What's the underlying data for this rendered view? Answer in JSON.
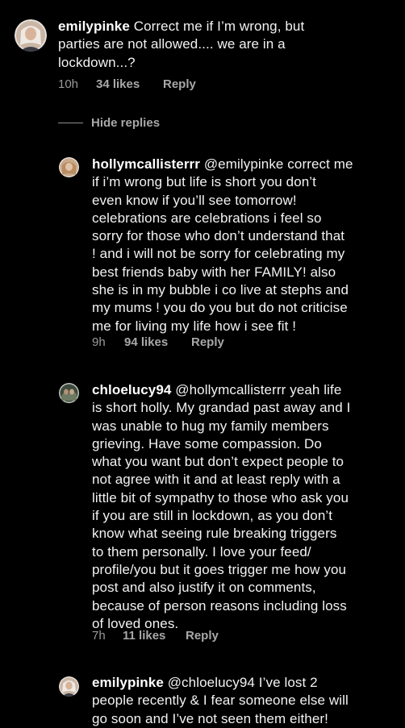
{
  "comments": [
    {
      "username": "emilypinke",
      "lines": [
        "Correct me if I’m wrong, but",
        "parties are not allowed.... we are in a",
        "lockdown...?"
      ],
      "time": "10h",
      "likes": "34 likes",
      "reply": "Reply"
    },
    {
      "username": "hollymcallisterrr",
      "lines": [
        "@emilypinke correct me",
        "if i’m wrong but life is short you don’t",
        "even know if you’ll see tomorrow!",
        "celebrations are celebrations i feel so",
        "sorry for those who don’t understand that",
        "! and i will not be sorry for celebrating my",
        "best friends baby with her FAMILY! also",
        "she is in my bubble i co live at stephs and",
        "my mums ! you do you but do not criticise",
        "me for living my life how i see fit !"
      ],
      "time": "9h",
      "likes": "94 likes",
      "reply": "Reply"
    },
    {
      "username": "chloelucy94",
      "lines": [
        "@hollymcallisterrr yeah life",
        "is short holly. My grandad past away and I",
        "was unable to hug my family members",
        "grieving. Have some compassion. Do",
        "what you want but don’t expect people to",
        "not agree with it and at least reply with a",
        "little bit of sympathy to those who ask you",
        "if you are still in lockdown, as you don’t",
        "know what seeing rule breaking triggers",
        "to them personally. I love your feed/",
        "profile/you but it goes trigger me how you",
        "post and also justify it on comments,",
        "because of person reasons including loss",
        "of loved ones."
      ],
      "time": "7h",
      "likes": "11 likes",
      "reply": "Reply"
    },
    {
      "username": "emilypinke",
      "lines": [
        "@chloelucy94 I’ve lost 2",
        "people recently & I fear someone else will",
        "go soon and I’ve not seen them either!"
      ]
    }
  ],
  "hide_replies": "Hide replies",
  "colors": {
    "background": "#000000",
    "text": "#f2f2f2",
    "muted": "#a8a8a8"
  }
}
